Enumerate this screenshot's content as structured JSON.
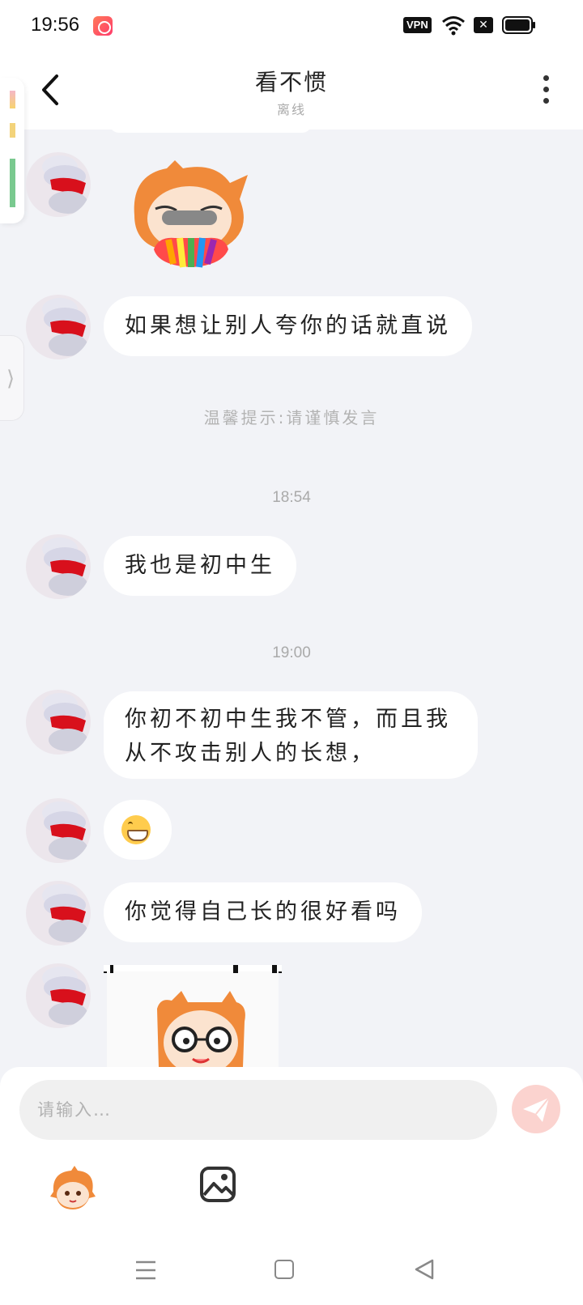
{
  "status_bar": {
    "time": "19:56",
    "vpn_label": "VPN",
    "icons": [
      "app-notification-icon",
      "wifi-icon",
      "close-box-icon",
      "battery-icon"
    ]
  },
  "header": {
    "title": "看不惯",
    "subtitle": "离线",
    "back_icon": "chevron-left-icon",
    "more_icon": "more-vertical-icon"
  },
  "messages": [
    {
      "type": "sticker",
      "description_icon": "rainbow-vomit-sticker"
    },
    {
      "type": "text",
      "text": "如果想让别人夸你的话就直说"
    },
    {
      "type": "system",
      "text": "温馨提示:请谨慎发言"
    },
    {
      "type": "time",
      "text": "18:54"
    },
    {
      "type": "text",
      "text": "我也是初中生"
    },
    {
      "type": "time",
      "text": "19:00"
    },
    {
      "type": "text",
      "lines": [
        "你初不初中生我不管，而且我",
        "从不攻击别人的长想，"
      ]
    },
    {
      "type": "emoji",
      "icon": "grinning-face-emoji"
    },
    {
      "type": "text",
      "text": "你觉得自己长的很好看吗"
    },
    {
      "type": "sticker",
      "description_icon": "glasses-girl-sticker"
    }
  ],
  "input": {
    "placeholder": "请输入…",
    "send_icon": "paper-plane-icon",
    "sticker_icon": "sticker-face-icon",
    "image_icon": "image-icon"
  },
  "nav": {
    "icons": [
      "menu-icon",
      "home-square-icon",
      "back-triangle-icon"
    ]
  },
  "colors": {
    "background": "#f2f3f7",
    "bubble": "#ffffff",
    "send_button": "#fbd3cf",
    "accent_orange": "#f08a3a"
  }
}
